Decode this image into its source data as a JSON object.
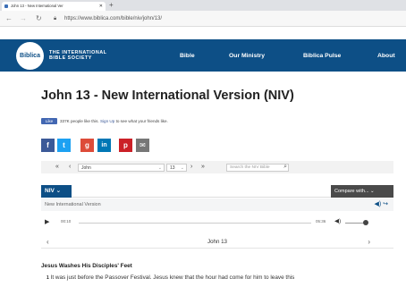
{
  "browser": {
    "tab_title": "John 13 - New International Ver",
    "url": "https://www.biblica.com/bible/niv/john/13/"
  },
  "site": {
    "logo_text": "Biblica",
    "tagline_line1": "THE INTERNATIONAL",
    "tagline_line2": "BIBLE SOCIETY",
    "menu": [
      "Bible",
      "Our Ministry",
      "Biblica Pulse",
      "About"
    ],
    "brand_color": "#0d4f86"
  },
  "page": {
    "title": "John 13 - New International Version (NIV)"
  },
  "facebook": {
    "like_label": "Like",
    "count_text": "337K people like this.",
    "signup_link": "Sign Up",
    "signup_rest": "to see what your friends like."
  },
  "share_icons": [
    "facebook-icon",
    "twitter-icon",
    "google-plus-icon",
    "linkedin-icon",
    "pinterest-icon",
    "email-icon"
  ],
  "toolbar": {
    "book_value": "John",
    "chapter_value": "13",
    "search_placeholder": "Search the NIV Bible"
  },
  "version": {
    "selected": "NIV",
    "compare_label": "Compare with..."
  },
  "audio": {
    "version_label": "New International Version",
    "current_time": "00:10",
    "total_time": "05:36"
  },
  "chapter": {
    "label": "John 13"
  },
  "passage": {
    "heading": "Jesus Washes His Disciples' Feet",
    "verse_number": "1",
    "verse_text": "It was just before the Passover Festival. Jesus knew that the hour had come for him to leave this"
  }
}
